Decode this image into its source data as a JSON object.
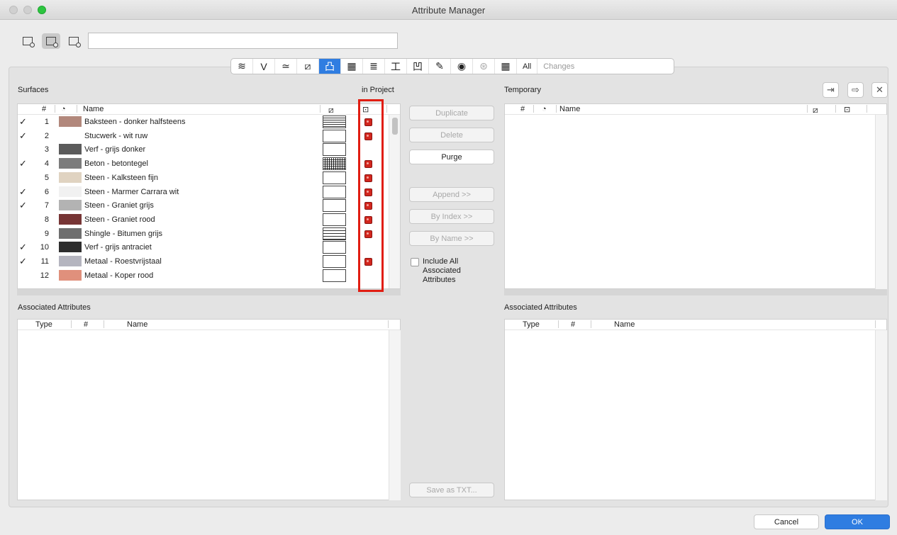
{
  "window": {
    "title": "Attribute Manager"
  },
  "search": {
    "value": ""
  },
  "tabs": [
    {
      "icon": "layers-icon",
      "glyph": "≋"
    },
    {
      "icon": "pen-icon",
      "glyph": "V"
    },
    {
      "icon": "line-type-icon",
      "glyph": "≃"
    },
    {
      "icon": "fill-icon",
      "glyph": "⧄"
    },
    {
      "icon": "surface-icon",
      "glyph": "凸",
      "selected": true
    },
    {
      "icon": "building-material-icon",
      "glyph": "▦"
    },
    {
      "icon": "composite-icon",
      "glyph": "≣"
    },
    {
      "icon": "profile-icon",
      "glyph": "工"
    },
    {
      "icon": "zone-icon",
      "glyph": "凹"
    },
    {
      "icon": "mep-icon",
      "glyph": "✎"
    },
    {
      "icon": "globe-icon",
      "glyph": "◉"
    },
    {
      "icon": "link-icon",
      "glyph": "⊛",
      "dim": true
    },
    {
      "icon": "table-icon",
      "glyph": "▦"
    }
  ],
  "tab_all_label": "All",
  "tab_changes_label": "Changes",
  "left": {
    "section_title": "Surfaces",
    "in_project_label": "in Project",
    "columns": {
      "index": "#",
      "name": "Name"
    },
    "rows": [
      {
        "check": "✓",
        "index": "1",
        "color": "#b2887c",
        "name": "Baksteen - donker halfsteens",
        "hatch": "h1",
        "in_project": true
      },
      {
        "check": "✓",
        "index": "2",
        "color": "#ffffff",
        "name": "Stucwerk - wit ruw",
        "hatch": "",
        "in_project": true
      },
      {
        "check": "",
        "index": "3",
        "color": "#5b5b5b",
        "name": "Verf - grijs donker",
        "hatch": "",
        "in_project": false
      },
      {
        "check": "✓",
        "index": "4",
        "color": "#7c7c7c",
        "name": "Beton - betontegel",
        "hatch": "h2",
        "in_project": true
      },
      {
        "check": "",
        "index": "5",
        "color": "#e0d3c1",
        "name": "Steen - Kalksteen fijn",
        "hatch": "",
        "in_project": true
      },
      {
        "check": "✓",
        "index": "6",
        "color": "#f1f1f1",
        "name": "Steen - Marmer Carrara wit",
        "hatch": "",
        "in_project": true
      },
      {
        "check": "✓",
        "index": "7",
        "color": "#b3b3b3",
        "name": "Steen - Graniet grijs",
        "hatch": "",
        "in_project": true
      },
      {
        "check": "",
        "index": "8",
        "color": "#773535",
        "name": "Steen - Graniet rood",
        "hatch": "",
        "in_project": true
      },
      {
        "check": "",
        "index": "9",
        "color": "#6e6e6e",
        "name": "Shingle - Bitumen grijs",
        "hatch": "h3",
        "in_project": true
      },
      {
        "check": "✓",
        "index": "10",
        "color": "#2e2e2e",
        "name": "Verf - grijs antraciet",
        "hatch": "",
        "in_project": false
      },
      {
        "check": "✓",
        "index": "11",
        "color": "#b5b5bf",
        "name": "Metaal - Roestvrijstaal",
        "hatch": "",
        "in_project": true
      },
      {
        "check": "",
        "index": "12",
        "color": "#e0907c",
        "name": "Metaal - Koper rood",
        "hatch": "",
        "in_project": false
      }
    ],
    "associated_title": "Associated Attributes",
    "assoc_columns": {
      "type": "Type",
      "index": "#",
      "name": "Name"
    }
  },
  "middle": {
    "duplicate": "Duplicate",
    "delete": "Delete",
    "purge": "Purge",
    "append": "Append >>",
    "by_index": "By Index >>",
    "by_name": "By Name >>",
    "include_all": "Include All Associated Attributes",
    "save_txt": "Save as TXT..."
  },
  "right": {
    "section_title": "Temporary",
    "columns": {
      "index": "#",
      "name": "Name"
    },
    "associated_title": "Associated Attributes",
    "assoc_columns": {
      "type": "Type",
      "index": "#",
      "name": "Name"
    }
  },
  "footer": {
    "cancel": "Cancel",
    "ok": "OK"
  }
}
